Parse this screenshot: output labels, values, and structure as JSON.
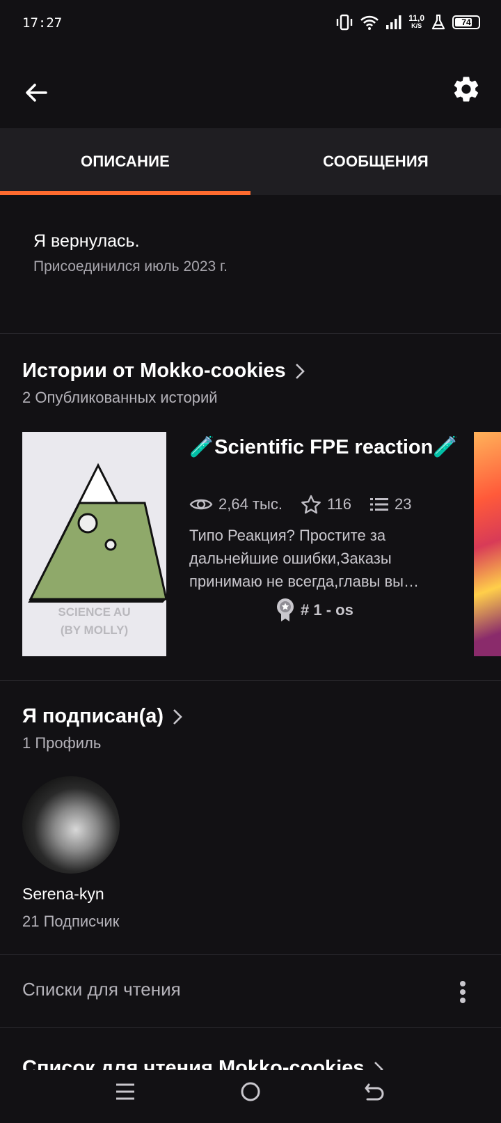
{
  "status_bar": {
    "time": "17:27",
    "net_speed_value": "11,0",
    "net_speed_unit": "K/S",
    "battery_level": 74,
    "icons": [
      "vibrate-icon",
      "wifi-icon",
      "signal-icon",
      "flask-icon",
      "battery-icon"
    ]
  },
  "top_bar": {
    "back_icon": "arrow-left-icon",
    "settings_icon": "gear-icon"
  },
  "tabs": [
    {
      "label": "ОПИСАНИЕ",
      "active": true
    },
    {
      "label": "СООБЩЕНИЯ",
      "active": false
    }
  ],
  "colors": {
    "accent": "#ff6b2f",
    "background": "#121114",
    "tab_bar": "#1f1e22"
  },
  "about": {
    "text": "Я вернулась.",
    "joined": "Присоединился июль 2023 г."
  },
  "stories_section": {
    "title": "Истории от Mokko-cookies",
    "subtitle": "2 Опубликованных историй",
    "stories": [
      {
        "cover_text_line1": "SCIENCE AU",
        "cover_text_line2": "(BY MOLLY)",
        "title": "🧪Scientific FPE reaction🧪",
        "reads": "2,64 тыс.",
        "votes": "116",
        "parts": "23",
        "description": "Типо Реакция? Простите за дальнейшие ошибки,Заказы принимаю не всегда,главы вы…",
        "rank": "# 1 - os"
      }
    ]
  },
  "following_section": {
    "title": "Я подписан(а)",
    "subtitle": "1 Профиль",
    "profiles": [
      {
        "name": "Serena-kyn",
        "followers": "21 Подписчик"
      }
    ]
  },
  "reading_lists": {
    "title": "Списки для чтения",
    "list_title": "Список для чтения Mokko-cookies"
  },
  "nav_bar": {
    "icons": [
      "menu-icon",
      "home-circle-icon",
      "back-gesture-icon"
    ]
  }
}
